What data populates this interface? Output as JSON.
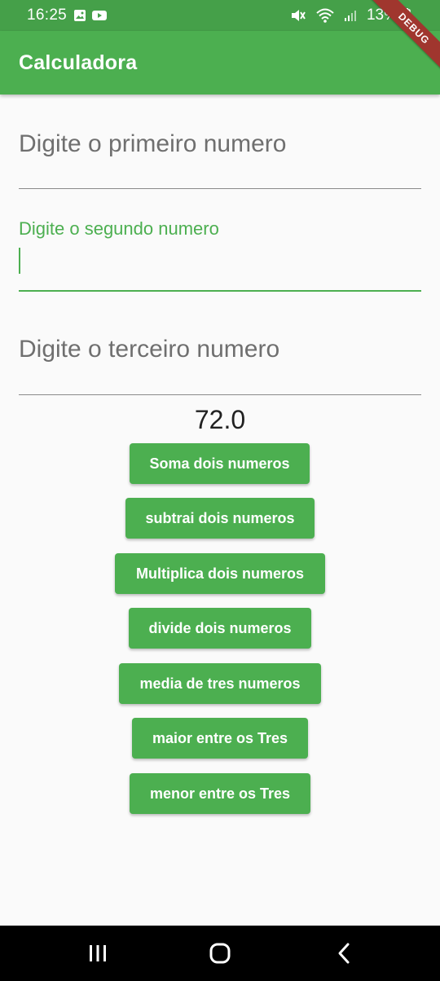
{
  "status_bar": {
    "time": "16:25",
    "battery": "13%"
  },
  "app_bar": {
    "title": "Calculadora"
  },
  "debug_banner": "DEBUG",
  "fields": {
    "first_label": "Digite o primeiro numero",
    "second_label": "Digite o segundo numero",
    "third_label": "Digite o terceiro numero"
  },
  "result": "72.0",
  "buttons": {
    "sum": "Soma dois numeros",
    "subtract": "subtrai dois numeros",
    "multiply": "Multiplica dois numeros",
    "divide": "divide dois numeros",
    "average": "media de tres numeros",
    "max": "maior entre os Tres",
    "min": "menor entre os Tres"
  },
  "colors": {
    "primary": "#4caf50",
    "status_bar": "#45a049",
    "debug": "#a0362e"
  }
}
